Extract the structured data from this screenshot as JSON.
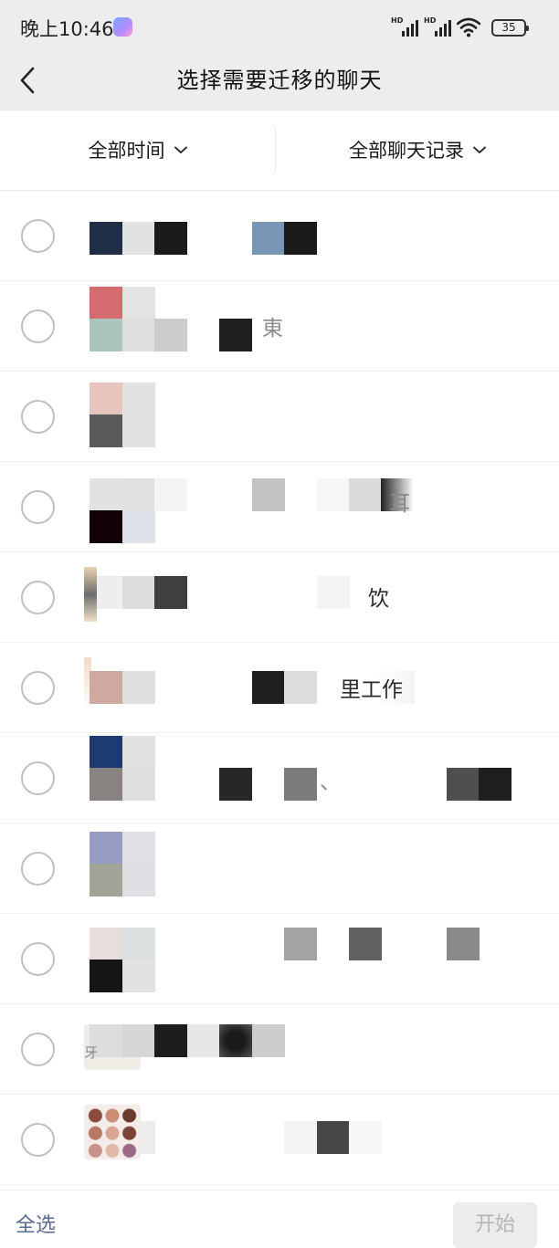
{
  "status_bar": {
    "time": "晚上10:46",
    "signal_labels": [
      "HD",
      "HD"
    ],
    "battery_level": "35"
  },
  "nav": {
    "title": "选择需要迁移的聊天"
  },
  "filters": {
    "time_filter": "全部时间",
    "record_filter": "全部聊天记录"
  },
  "chats": [
    {
      "visible_text": ""
    },
    {
      "visible_text": "東"
    },
    {
      "visible_text": ""
    },
    {
      "visible_text": "耳"
    },
    {
      "visible_text": "饮"
    },
    {
      "visible_text": "里工作"
    },
    {
      "visible_text": "、"
    },
    {
      "visible_text": ""
    },
    {
      "visible_text": ""
    },
    {
      "visible_text": "牙"
    },
    {
      "visible_text": ""
    }
  ],
  "bottom_bar": {
    "select_all": "全选",
    "start": "开始"
  },
  "colors": {
    "bar_bg": "#ededed",
    "link_blue": "#576b95",
    "disabled_button": "#ececec"
  }
}
